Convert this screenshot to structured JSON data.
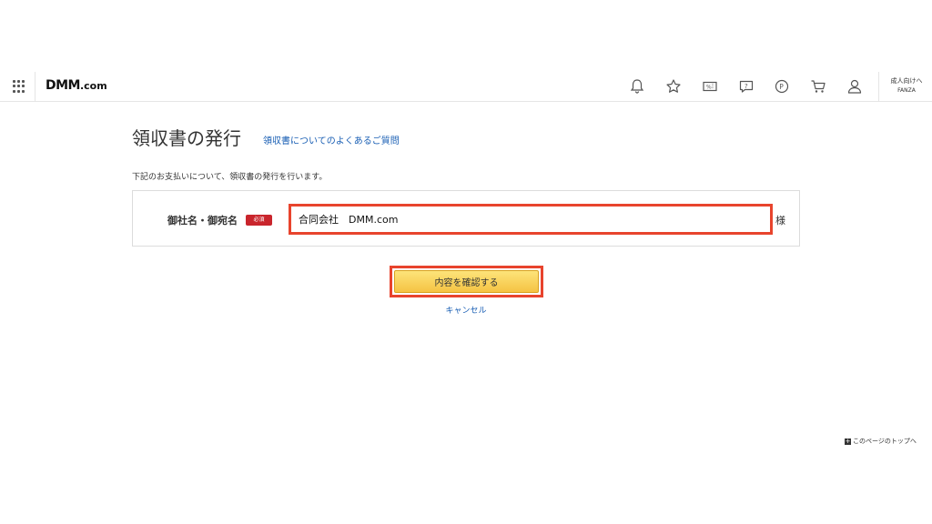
{
  "header": {
    "logo_main": "DMM",
    "logo_suffix": ".com",
    "icons": [
      "grid-menu-icon",
      "bell-icon",
      "star-icon",
      "coupon-icon",
      "help-chat-icon",
      "point-icon",
      "cart-icon",
      "user-icon"
    ],
    "adult_link_line1": "成人向けへ",
    "adult_link_line2": "FANZA"
  },
  "main": {
    "title": "領収書の発行",
    "faq_link": "領収書についてのよくあるご質問",
    "lead": "下記のお支払いについて、領収書の発行を行います。",
    "form": {
      "label": "御社名・御宛名",
      "required_badge": "必須",
      "name_value": "合同会社　DMM.com",
      "honorific": "様"
    },
    "confirm_button": "内容を確認する",
    "cancel_link": "キャンセル"
  },
  "footer": {
    "page_top_icon": "+",
    "page_top": "このページのトップへ"
  },
  "colors": {
    "highlight": "#e8442d",
    "link": "#1a5fb4",
    "button_yellow": "#f5c343",
    "required_red": "#c9252c"
  }
}
